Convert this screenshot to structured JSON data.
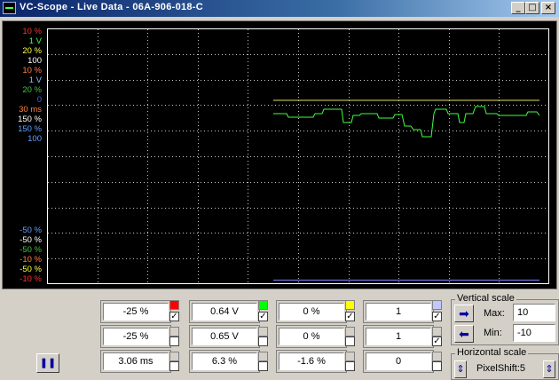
{
  "window": {
    "title": "VC-Scope  -  Live Data  -  06A-906-018-C",
    "minimize": "_",
    "maximize": "□",
    "close": "×"
  },
  "scale_labels_top": [
    {
      "text": "10 %",
      "color": "#ff3030"
    },
    {
      "text": "1 V",
      "color": "#40ff40"
    },
    {
      "text": "20 %",
      "color": "#ffff40"
    },
    {
      "text": "100",
      "color": "#ffffff"
    },
    {
      "text": "10 %",
      "color": "#ff8040"
    },
    {
      "text": "1 V",
      "color": "#80c0ff"
    },
    {
      "text": "20 %",
      "color": "#40c040"
    },
    {
      "text": "0",
      "color": "#4060ff"
    },
    {
      "text": "30 ms",
      "color": "#ff8040"
    },
    {
      "text": "150 %",
      "color": "#ffffff"
    },
    {
      "text": "150 %",
      "color": "#60a0ff"
    },
    {
      "text": "100",
      "color": "#60a0ff"
    }
  ],
  "scale_labels_bottom": [
    {
      "text": "-50 %",
      "color": "#60a0ff"
    },
    {
      "text": "-50 %",
      "color": "#ffffff"
    },
    {
      "text": "-50 %",
      "color": "#40c040"
    },
    {
      "text": "-10 %",
      "color": "#ff8040"
    },
    {
      "text": "-50 %",
      "color": "#ffff40"
    },
    {
      "text": "-10 %",
      "color": "#ff3030"
    }
  ],
  "channels": [
    {
      "row1": "-25 %",
      "row2": "-25 %",
      "row3": "3.06 ms",
      "color": "#ff0000",
      "checks": [
        true,
        false,
        false
      ]
    },
    {
      "row1": "0.64 V",
      "row2": "0.65 V",
      "row3": "6.3 %",
      "color": "#00ff00",
      "checks": [
        true,
        false,
        false
      ]
    },
    {
      "row1": "0 %",
      "row2": "0 %",
      "row3": "-1.6 %",
      "color": "#ffff00",
      "checks": [
        true,
        false,
        false
      ]
    },
    {
      "row1": "1",
      "row2": "1",
      "row3": "0",
      "color": "#c0c8ff",
      "checks": [
        true,
        true,
        false
      ]
    }
  ],
  "vertical_scale": {
    "title": "Vertical scale",
    "max_label": "Max:",
    "max_value": "10",
    "min_label": "Min:",
    "min_value": "-10"
  },
  "horizontal_scale": {
    "title": "Horizontal scale",
    "pixel_shift": "PixelShift:5"
  },
  "pause_button": "❚❚",
  "arrows": {
    "right": "➡",
    "left": "⬅",
    "up_down": "⇕"
  },
  "chart_data": {
    "type": "line",
    "series": [
      {
        "color": "#e0e060",
        "values": [
          [
            255,
            81
          ],
          [
            555,
            81
          ]
        ]
      },
      {
        "color": "#40ff40",
        "values": [
          [
            255,
            96
          ],
          [
            270,
            96
          ],
          [
            272,
            100
          ],
          [
            300,
            100
          ],
          [
            302,
            96
          ],
          [
            310,
            96
          ],
          [
            312,
            91
          ],
          [
            332,
            91
          ],
          [
            334,
            106
          ],
          [
            343,
            106
          ],
          [
            345,
            98
          ],
          [
            352,
            98
          ],
          [
            354,
            96
          ],
          [
            372,
            96
          ],
          [
            374,
            101
          ],
          [
            390,
            101
          ],
          [
            392,
            97
          ],
          [
            400,
            97
          ],
          [
            403,
            110
          ],
          [
            410,
            110
          ],
          [
            413,
            114
          ],
          [
            421,
            114
          ],
          [
            423,
            122
          ],
          [
            433,
            122
          ],
          [
            436,
            96
          ],
          [
            438,
            91
          ],
          [
            450,
            91
          ],
          [
            452,
            96
          ],
          [
            463,
            96
          ],
          [
            465,
            106
          ],
          [
            470,
            106
          ],
          [
            472,
            96
          ],
          [
            480,
            96
          ],
          [
            483,
            88
          ],
          [
            493,
            88
          ],
          [
            495,
            96
          ],
          [
            507,
            96
          ],
          [
            509,
            98
          ],
          [
            540,
            98
          ],
          [
            542,
            94
          ],
          [
            552,
            94
          ],
          [
            555,
            98
          ]
        ]
      }
    ],
    "grid": true
  }
}
